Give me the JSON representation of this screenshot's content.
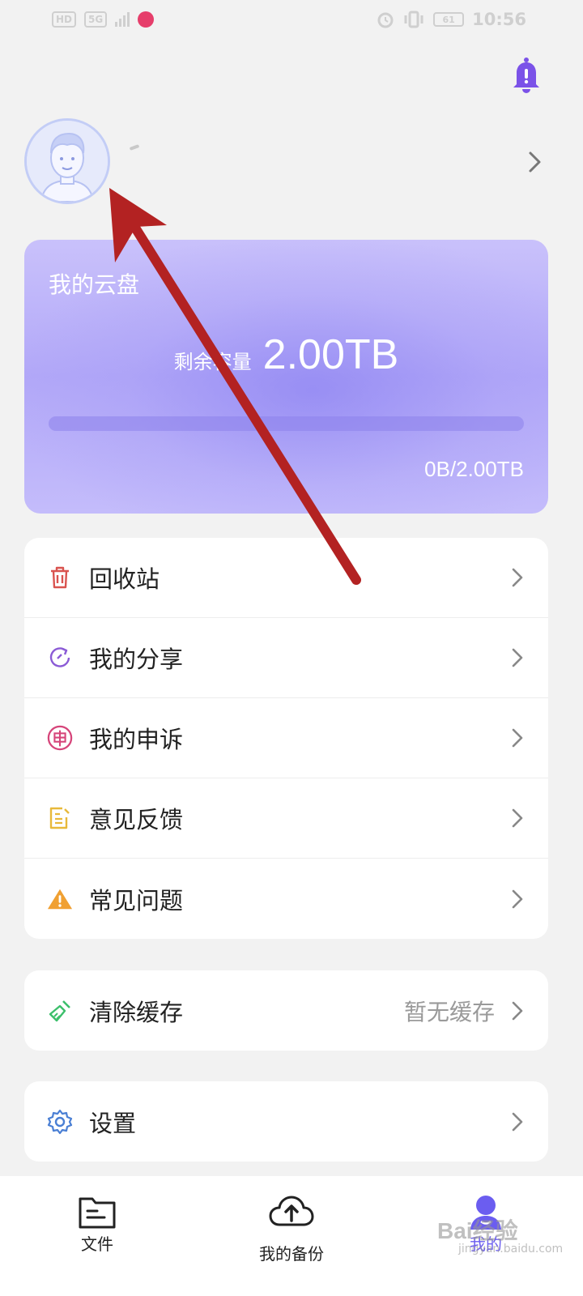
{
  "status_bar": {
    "left_chip": "HD",
    "network": "5G",
    "battery": "61",
    "time": "10:56"
  },
  "profile": {
    "avatar_icon": "user-avatar-icon",
    "chevron_icon": "chevron-right-icon"
  },
  "cloud": {
    "title": "我的云盘",
    "remaining_label": "剩余容量",
    "remaining_value": "2.00TB",
    "usage": "0B/2.00TB",
    "used_fraction": 0
  },
  "menu": [
    {
      "key": "recycle",
      "label": "回收站",
      "icon": "trash-icon",
      "color": "#d9534f"
    },
    {
      "key": "share",
      "label": "我的分享",
      "icon": "share-icon",
      "color": "#8b5bd6"
    },
    {
      "key": "appeal",
      "label": "我的申诉",
      "icon": "appeal-icon",
      "color": "#d6457a"
    },
    {
      "key": "feedback",
      "label": "意见反馈",
      "icon": "feedback-icon",
      "color": "#e8b93a"
    },
    {
      "key": "faq",
      "label": "常见问题",
      "icon": "warning-icon",
      "color": "#f0a032"
    }
  ],
  "cache": {
    "label": "清除缓存",
    "value": "暂无缓存",
    "icon": "broom-icon",
    "color": "#3cbf6b"
  },
  "settings": {
    "label": "设置",
    "icon": "gear-icon",
    "color": "#4a7fd4"
  },
  "tabs": [
    {
      "label": "文件",
      "icon": "folder-icon"
    },
    {
      "label": "我的备份",
      "icon": "cloud-upload-icon"
    },
    {
      "label": "我的",
      "icon": "profile-icon",
      "active": true
    }
  ],
  "watermark": {
    "text": "Bai经验",
    "sub": "jingyan.baidu.com"
  },
  "colors": {
    "accent": "#6b5df0",
    "annotation_arrow": "#b32222"
  }
}
